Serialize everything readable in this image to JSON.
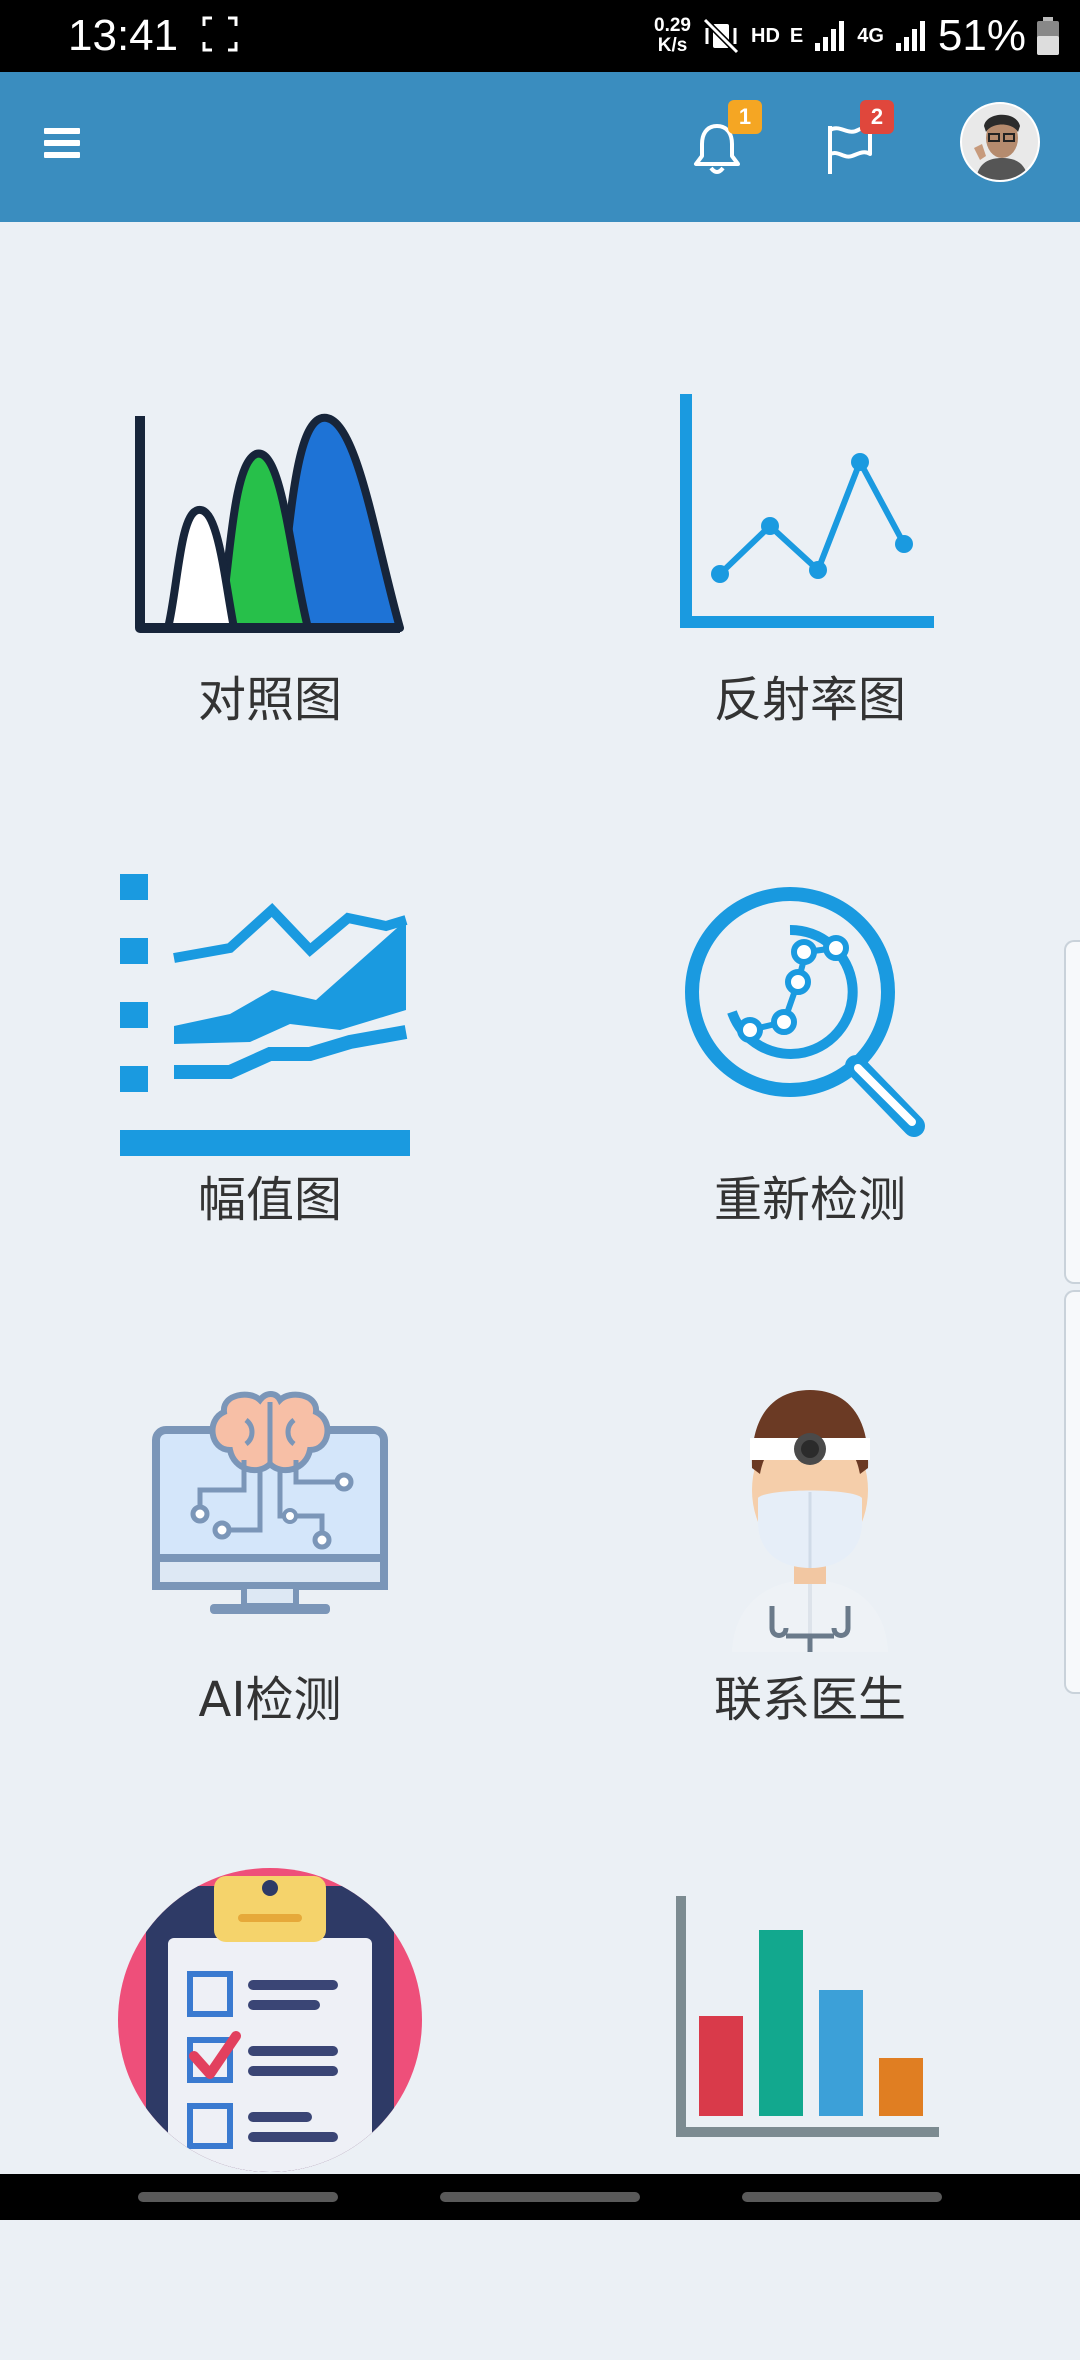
{
  "status_bar": {
    "time": "13:41",
    "speed_value": "0.29",
    "speed_unit": "K/s",
    "hd": "HD",
    "net1": "E",
    "net2": "4G",
    "battery": "51%"
  },
  "app_bar": {
    "menu_icon": "hamburger-icon",
    "notifications_count": "1",
    "flags_count": "2"
  },
  "tiles": [
    {
      "label": "对照图",
      "icon": "overlapping-peaks-chart-icon"
    },
    {
      "label": "反射率图",
      "icon": "line-chart-icon"
    },
    {
      "label": "幅值图",
      "icon": "area-chart-icon"
    },
    {
      "label": "重新检测",
      "icon": "magnifier-icon"
    },
    {
      "label": "AI检测",
      "icon": "ai-brain-monitor-icon"
    },
    {
      "label": "联系医生",
      "icon": "doctor-icon"
    },
    {
      "label": "",
      "icon": "clipboard-checklist-icon"
    },
    {
      "label": "",
      "icon": "bar-chart-icon"
    }
  ],
  "colors": {
    "app_bar": "#3a8dbf",
    "background": "#ebf0f5",
    "badge_orange": "#f5a623",
    "badge_red": "#e0473c",
    "accent_blue": "#1a9ae0"
  }
}
